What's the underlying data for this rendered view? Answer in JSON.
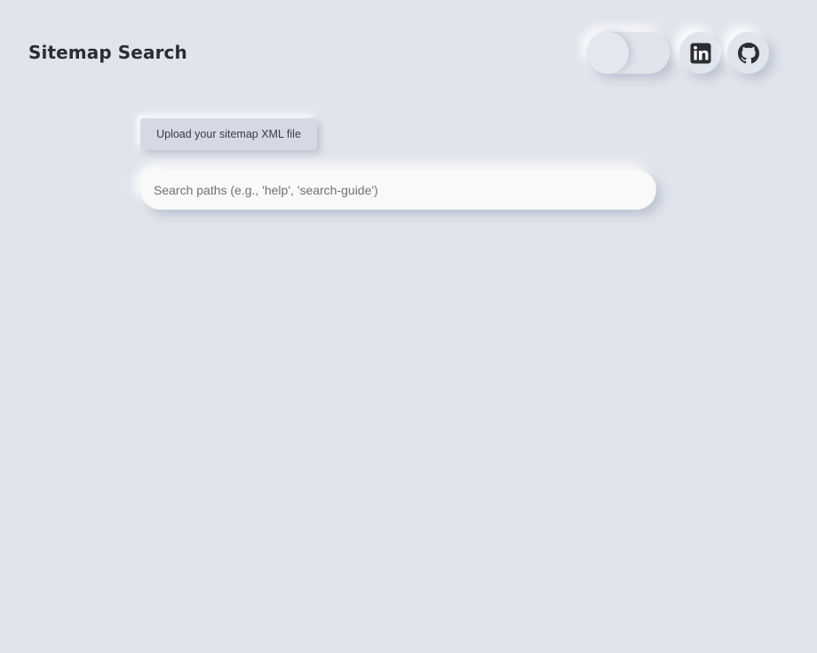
{
  "header": {
    "title": "Sitemap Search"
  },
  "toggle": {
    "state": "off",
    "name": "theme-toggle"
  },
  "links": [
    {
      "name": "linkedin-icon"
    },
    {
      "name": "github-icon"
    }
  ],
  "upload": {
    "label": "Upload your sitemap XML file"
  },
  "search": {
    "placeholder": "Search paths (e.g., 'help', 'search-guide')",
    "value": ""
  },
  "colors": {
    "background": "#e0e4ec",
    "title": "#2b2d33",
    "upload_bg": "#d4d9e5",
    "search_bg": "#f9f9fa",
    "icon": "#2b2d33"
  }
}
